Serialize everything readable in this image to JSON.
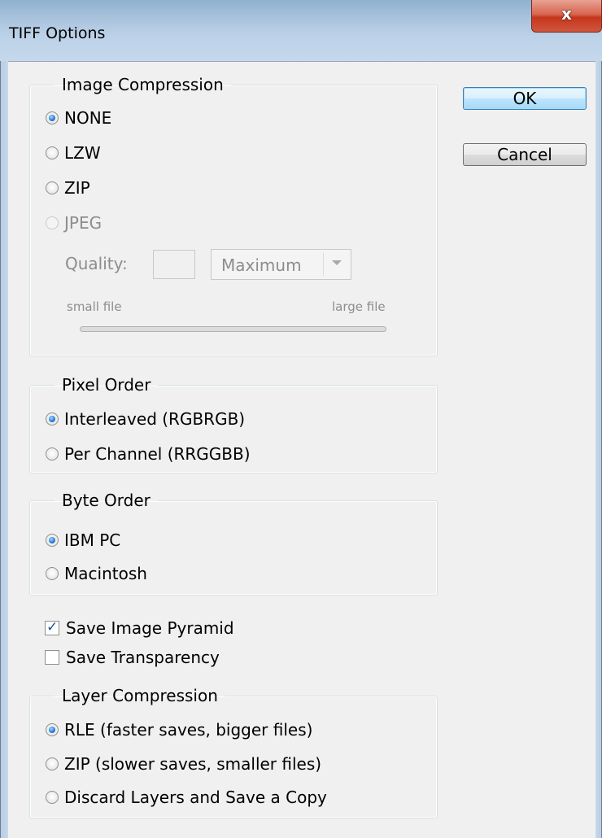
{
  "window": {
    "title": "TIFF Options",
    "close_glyph": "x"
  },
  "buttons": {
    "ok": "OK",
    "cancel": "Cancel"
  },
  "image_compression": {
    "legend": "Image Compression",
    "options": [
      "NONE",
      "LZW",
      "ZIP",
      "JPEG"
    ],
    "selected": "NONE",
    "disabled": [
      "JPEG"
    ],
    "quality_label": "Quality:",
    "quality_value": "",
    "quality_preset": "Maximum",
    "slider_min_label": "small file",
    "slider_max_label": "large file"
  },
  "pixel_order": {
    "legend": "Pixel Order",
    "options": [
      "Interleaved (RGBRGB)",
      "Per Channel (RRGGBB)"
    ],
    "selected": "Interleaved (RGBRGB)"
  },
  "byte_order": {
    "legend": "Byte Order",
    "options": [
      "IBM PC",
      "Macintosh"
    ],
    "selected": "IBM PC"
  },
  "checkboxes": {
    "save_image_pyramid": {
      "label": "Save Image Pyramid",
      "checked": true
    },
    "save_transparency": {
      "label": "Save Transparency",
      "checked": false
    }
  },
  "layer_compression": {
    "legend": "Layer Compression",
    "options": [
      "RLE (faster saves, bigger files)",
      "ZIP (slower saves, smaller files)",
      "Discard Layers and Save a Copy"
    ],
    "selected": "RLE (faster saves, bigger files)"
  },
  "colors": {
    "accent": "#2a7fd6",
    "disabled_text": "#8d8d8d",
    "dialog_bg": "#f0f0f0"
  }
}
